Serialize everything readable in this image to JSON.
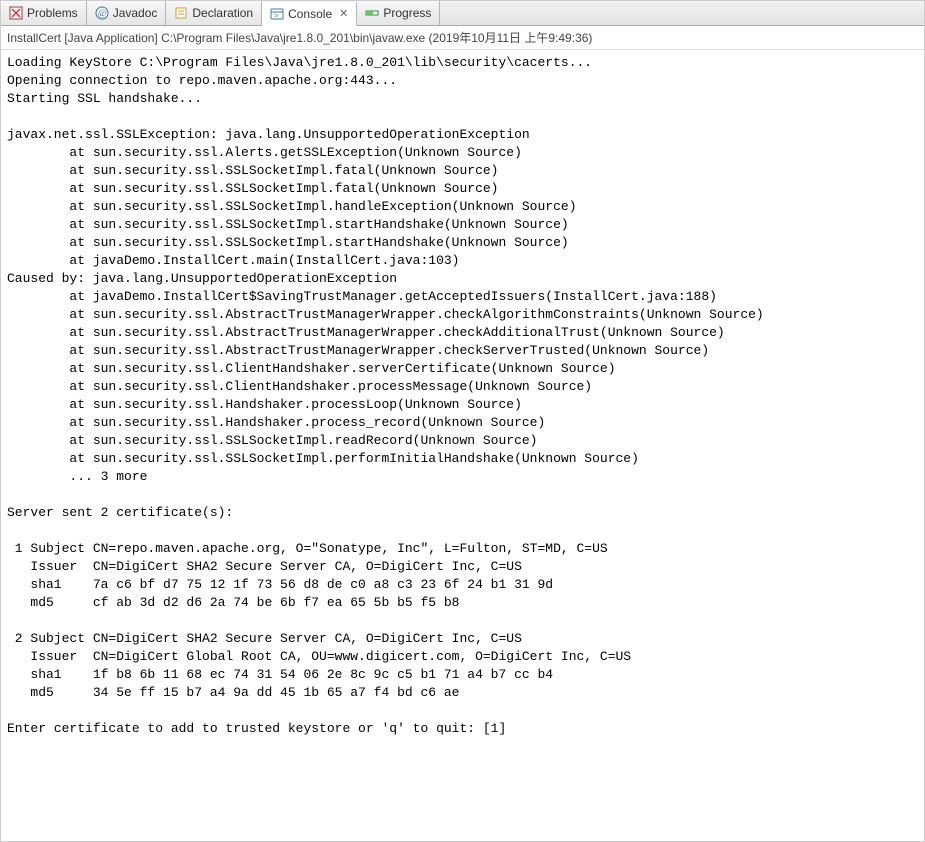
{
  "tabs": {
    "problems": "Problems",
    "javadoc": "Javadoc",
    "declaration": "Declaration",
    "console": "Console",
    "progress": "Progress"
  },
  "launch": "InstallCert [Java Application] C:\\Program Files\\Java\\jre1.8.0_201\\bin\\javaw.exe (2019年10月11日 上午9:49:36)",
  "console_lines": [
    "Loading KeyStore C:\\Program Files\\Java\\jre1.8.0_201\\lib\\security\\cacerts...",
    "Opening connection to repo.maven.apache.org:443...",
    "Starting SSL handshake...",
    "",
    "javax.net.ssl.SSLException: java.lang.UnsupportedOperationException",
    "        at sun.security.ssl.Alerts.getSSLException(Unknown Source)",
    "        at sun.security.ssl.SSLSocketImpl.fatal(Unknown Source)",
    "        at sun.security.ssl.SSLSocketImpl.fatal(Unknown Source)",
    "        at sun.security.ssl.SSLSocketImpl.handleException(Unknown Source)",
    "        at sun.security.ssl.SSLSocketImpl.startHandshake(Unknown Source)",
    "        at sun.security.ssl.SSLSocketImpl.startHandshake(Unknown Source)",
    "        at javaDemo.InstallCert.main(InstallCert.java:103)",
    "Caused by: java.lang.UnsupportedOperationException",
    "        at javaDemo.InstallCert$SavingTrustManager.getAcceptedIssuers(InstallCert.java:188)",
    "        at sun.security.ssl.AbstractTrustManagerWrapper.checkAlgorithmConstraints(Unknown Source)",
    "        at sun.security.ssl.AbstractTrustManagerWrapper.checkAdditionalTrust(Unknown Source)",
    "        at sun.security.ssl.AbstractTrustManagerWrapper.checkServerTrusted(Unknown Source)",
    "        at sun.security.ssl.ClientHandshaker.serverCertificate(Unknown Source)",
    "        at sun.security.ssl.ClientHandshaker.processMessage(Unknown Source)",
    "        at sun.security.ssl.Handshaker.processLoop(Unknown Source)",
    "        at sun.security.ssl.Handshaker.process_record(Unknown Source)",
    "        at sun.security.ssl.SSLSocketImpl.readRecord(Unknown Source)",
    "        at sun.security.ssl.SSLSocketImpl.performInitialHandshake(Unknown Source)",
    "        ... 3 more",
    "",
    "Server sent 2 certificate(s):",
    "",
    " 1 Subject CN=repo.maven.apache.org, O=\"Sonatype, Inc\", L=Fulton, ST=MD, C=US",
    "   Issuer  CN=DigiCert SHA2 Secure Server CA, O=DigiCert Inc, C=US",
    "   sha1    7a c6 bf d7 75 12 1f 73 56 d8 de c0 a8 c3 23 6f 24 b1 31 9d",
    "   md5     cf ab 3d d2 d6 2a 74 be 6b f7 ea 65 5b b5 f5 b8",
    "",
    " 2 Subject CN=DigiCert SHA2 Secure Server CA, O=DigiCert Inc, C=US",
    "   Issuer  CN=DigiCert Global Root CA, OU=www.digicert.com, O=DigiCert Inc, C=US",
    "   sha1    1f b8 6b 11 68 ec 74 31 54 06 2e 8c 9c c5 b1 71 a4 b7 cc b4",
    "   md5     34 5e ff 15 b7 a4 9a dd 45 1b 65 a7 f4 bd c6 ae",
    "",
    "Enter certificate to add to trusted keystore or 'q' to quit: [1]"
  ]
}
